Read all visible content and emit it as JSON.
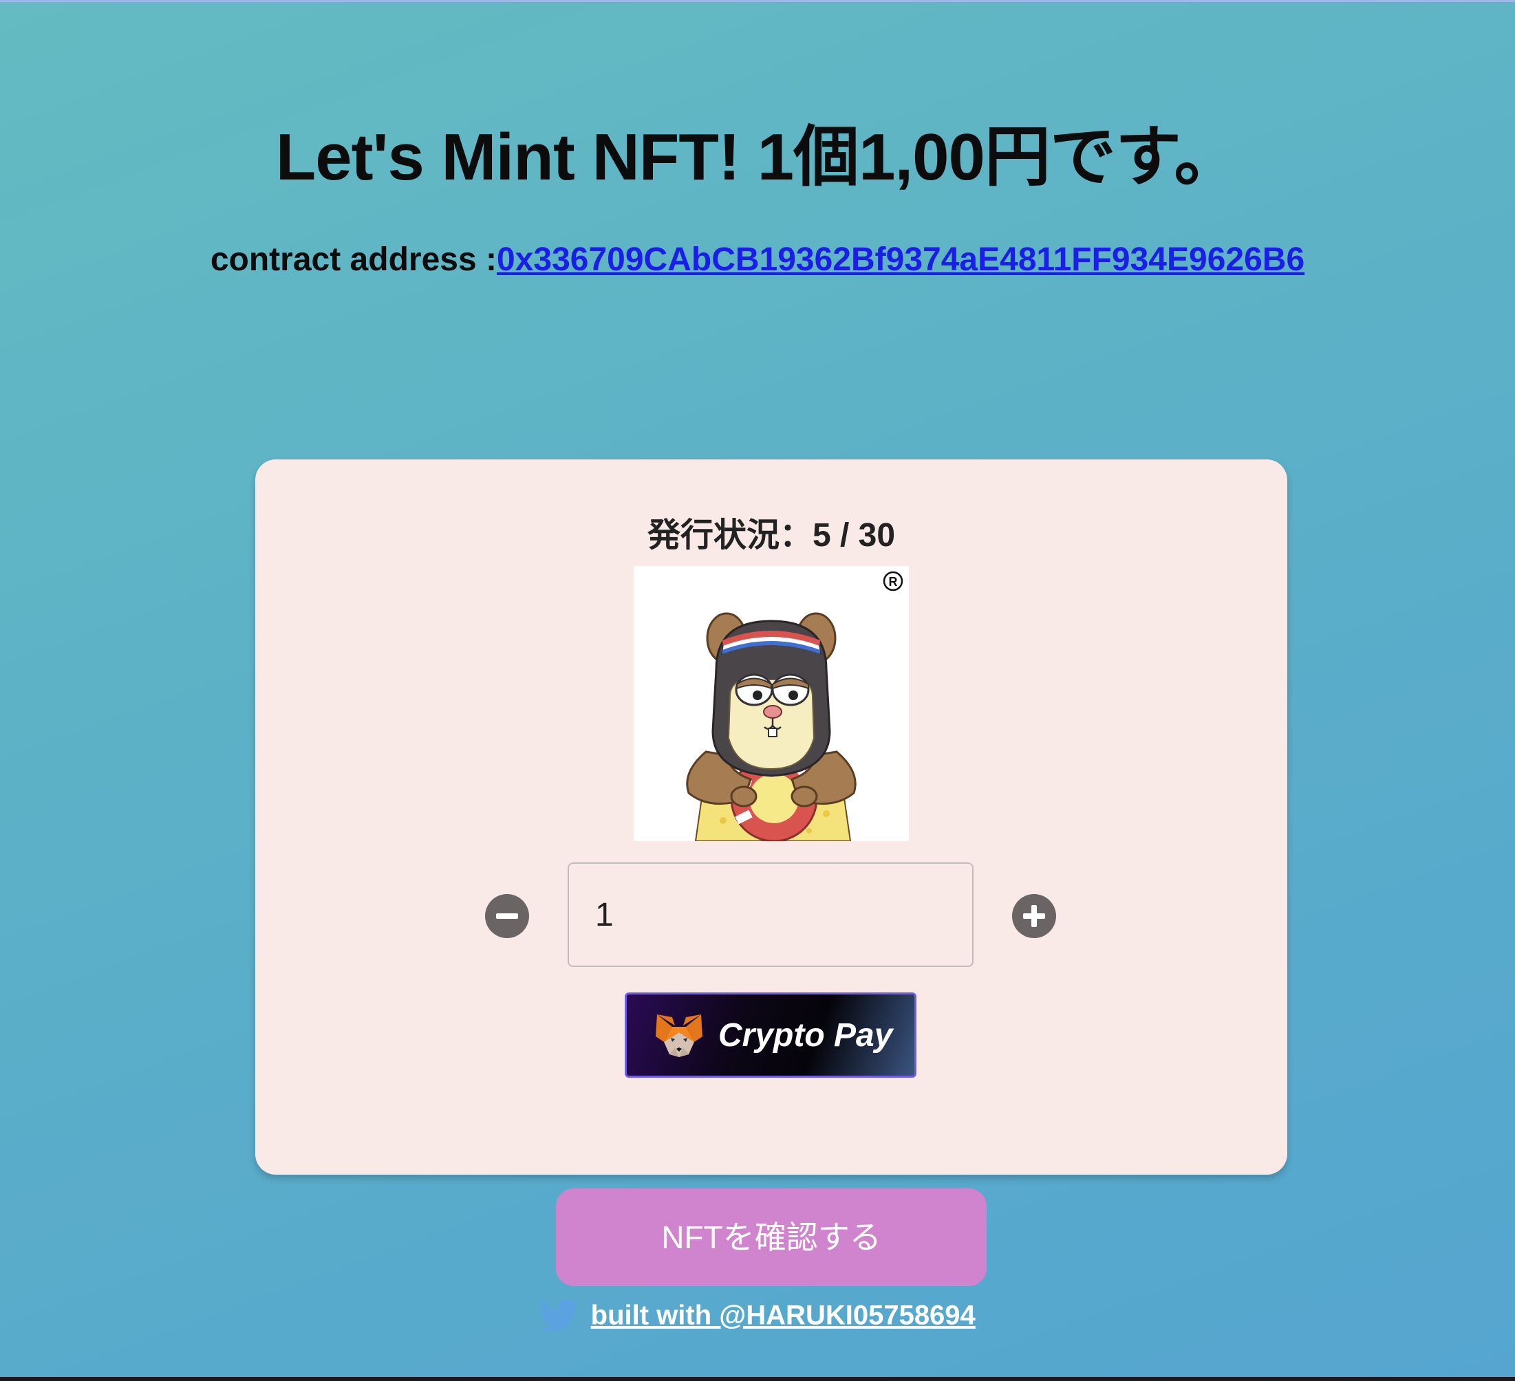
{
  "header": {
    "title": "Let's Mint NFT! 1個1,00円です。",
    "contract_label": "contract address :",
    "contract_address": "0x336709CAbCB19362Bf9374aE4811FF934E9626B6"
  },
  "card": {
    "mint_status": "発行状況：5 / 30",
    "image_icon": "hamster-nft-image",
    "quantity_value": "1",
    "minus_icon": "minus-circle-icon",
    "plus_icon": "plus-circle-icon",
    "pay_button_label": "Crypto Pay",
    "pay_button_icon": "metamask-fox-icon"
  },
  "actions": {
    "check_nft_label": "NFTを確認する"
  },
  "footer": {
    "icon": "twitter-icon",
    "link_text": "built with @HARUKI05758694"
  },
  "colors": {
    "link": "#1a1ee6",
    "card_bg": "#f9e9e7",
    "check_button_bg": "#d084cd",
    "twitter_blue": "#5ba3e0"
  }
}
